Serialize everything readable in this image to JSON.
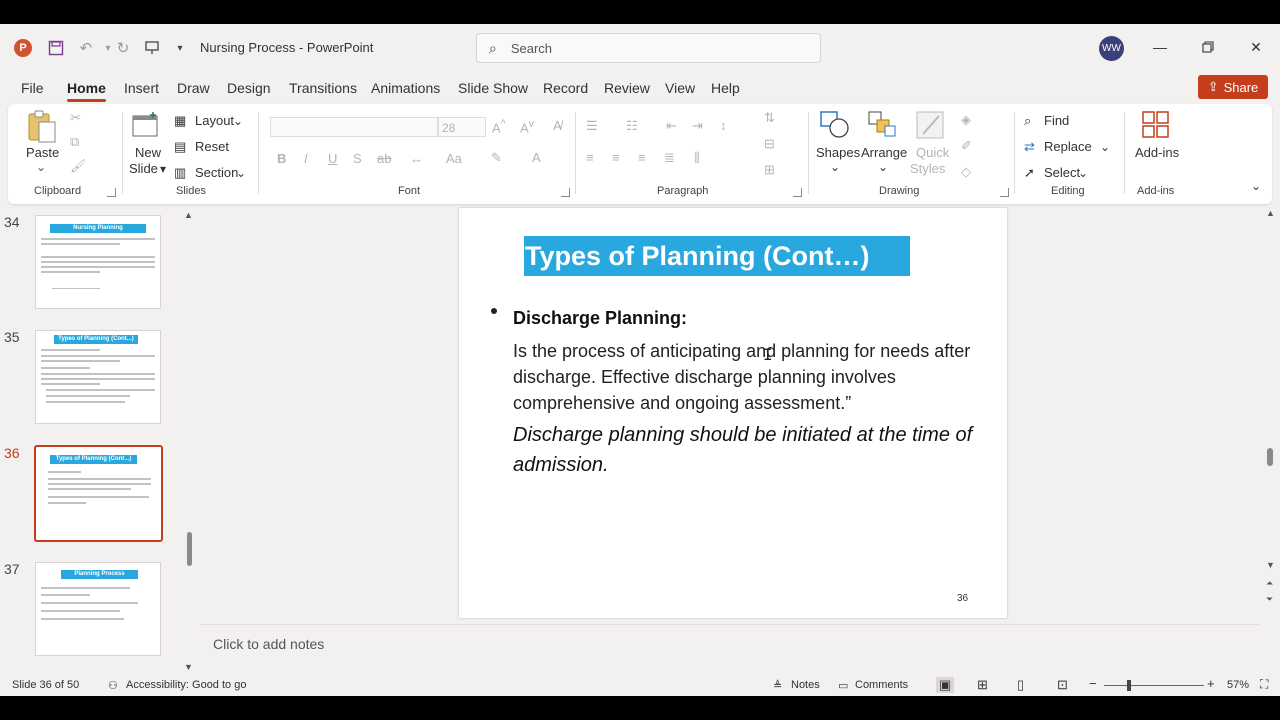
{
  "titlebar": {
    "doc_title": "Nursing Process  -  PowerPoint",
    "search_placeholder": "Search",
    "avatar_initials": "WW"
  },
  "tabs": [
    "File",
    "Home",
    "Insert",
    "Draw",
    "Design",
    "Transitions",
    "Animations",
    "Slide Show",
    "Record",
    "Review",
    "View",
    "Help"
  ],
  "active_tab": "Home",
  "share_label": "Share",
  "ribbon": {
    "clipboard": {
      "paste": "Paste",
      "label": "Clipboard"
    },
    "slides": {
      "new_slide_1": "New",
      "new_slide_2": "Slide",
      "layout": "Layout",
      "reset": "Reset",
      "section": "Section",
      "label": "Slides"
    },
    "font": {
      "size": "28",
      "label": "Font"
    },
    "paragraph": {
      "label": "Paragraph"
    },
    "drawing": {
      "shapes": "Shapes",
      "arrange": "Arrange",
      "quick_styles_1": "Quick",
      "quick_styles_2": "Styles",
      "label": "Drawing"
    },
    "editing": {
      "find": "Find",
      "replace": "Replace",
      "select": "Select",
      "label": "Editing"
    },
    "addins": {
      "button": "Add-ins",
      "label": "Add-ins"
    }
  },
  "thumbnails": [
    {
      "number": "34",
      "title": "Nursing Planning"
    },
    {
      "number": "35",
      "title": "Types of Planning (Cont...)"
    },
    {
      "number": "36",
      "title": "Types of Planning (Cont...)",
      "selected": true
    },
    {
      "number": "37",
      "title": "Planning Process"
    }
  ],
  "slide": {
    "title": "Types of Planning (Cont…)",
    "heading": "Discharge Planning:",
    "body": "Is the process of anticipating and planning for needs after discharge. Effective discharge planning involves comprehensive and ongoing assessment.”",
    "italic": "Discharge planning should be initiated at the time of admission.",
    "number": "36"
  },
  "notes_placeholder": "Click to add notes",
  "status": {
    "slide_info": "Slide 36 of 50",
    "accessibility": "Accessibility: Good to go",
    "notes": "Notes",
    "comments": "Comments",
    "zoom": "57%"
  },
  "colors": {
    "accent": "#c43e1c",
    "title_fill": "#29a8df"
  }
}
